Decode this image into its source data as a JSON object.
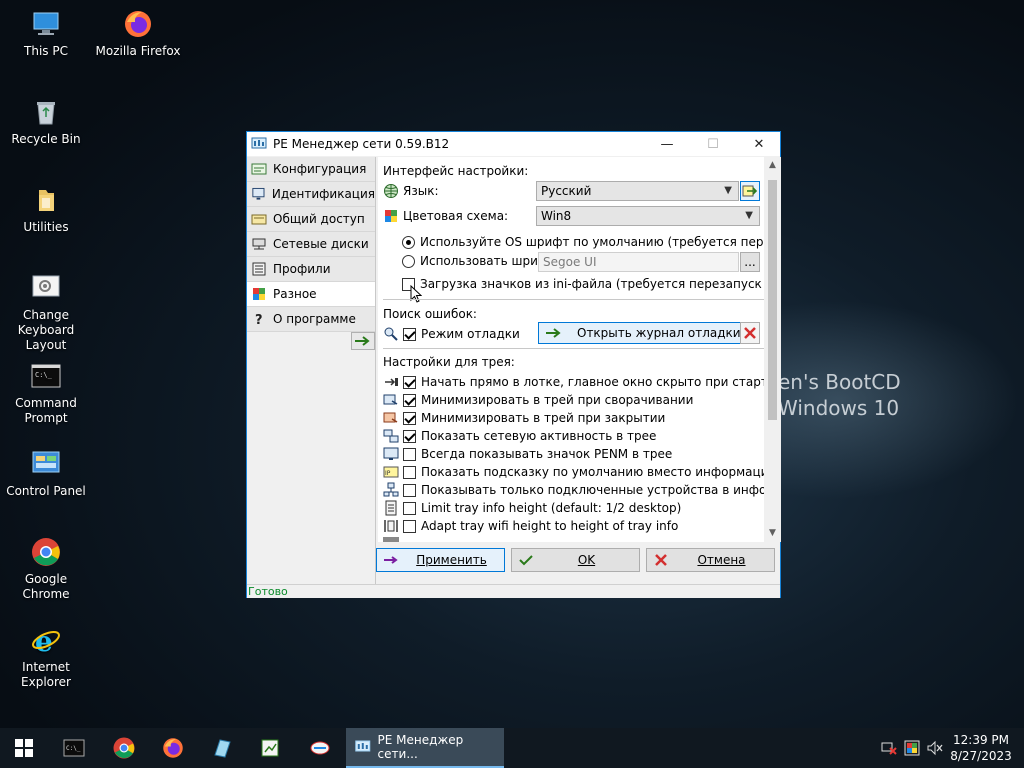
{
  "desktop": {
    "background_text": [
      "en's BootCD",
      "Windows 10"
    ],
    "icons": [
      {
        "label": "This PC",
        "icon": "computer-icon"
      },
      {
        "label": "Mozilla Firefox",
        "icon": "firefox-icon"
      },
      {
        "label": "Recycle Bin",
        "icon": "recycle-bin-icon"
      },
      {
        "label": "Utilities",
        "icon": "folder-icon"
      },
      {
        "label": "Change\nKeyboard Layout",
        "icon": "keyboard-layout-icon"
      },
      {
        "label": "Command\nPrompt",
        "icon": "command-prompt-icon"
      },
      {
        "label": "Control Panel",
        "icon": "control-panel-icon"
      },
      {
        "label": "Google Chrome",
        "icon": "chrome-icon"
      },
      {
        "label": "Internet Explorer",
        "icon": "internet-explorer-icon"
      }
    ]
  },
  "window": {
    "title": "PE Менеджер сети 0.59.B12",
    "controls": {
      "minimize": "—",
      "maximize": "☐",
      "close": "✕"
    },
    "nav": [
      {
        "label": "Конфигурация",
        "icon": "network-config-icon"
      },
      {
        "label": "Идентификация",
        "icon": "monitor-icon"
      },
      {
        "label": "Общий доступ",
        "icon": "share-folder-icon"
      },
      {
        "label": "Сетевые диски",
        "icon": "network-drive-icon"
      },
      {
        "label": "Профили",
        "icon": "profile-icon"
      },
      {
        "label": "Разное",
        "icon": "misc-icon",
        "active": true
      },
      {
        "label": "О программе",
        "icon": "question-icon"
      }
    ],
    "interface": {
      "section_label": "Интерфейс настройки:",
      "language_label": "Язык:",
      "language_value": "Русский",
      "color_scheme_label": "Цветовая схема:",
      "color_scheme_value": "Win8",
      "os_font_label": "Используйте OS шрифт по умолчанию (требуется перезапуск GU",
      "custom_font_label": "Использовать шрифт:",
      "custom_font_value": "Segoe UI",
      "font_browse_label": "...",
      "load_icons_label": "Загрузка значков из ini-файла (требуется перезапуск GUI)"
    },
    "debug": {
      "section_label": "Поиск ошибок:",
      "debug_mode_label": "Режим отладки",
      "open_log_label": "Открыть журнал отладки..."
    },
    "tray": {
      "section_label": "Настройки для трея:",
      "items": [
        {
          "label": "Начать прямо в лотке, главное окно скрыто при старте програм",
          "checked": true
        },
        {
          "label": "Минимизировать в трей при сворачивании",
          "checked": true
        },
        {
          "label": "Минимизировать в трей при закрытии",
          "checked": true
        },
        {
          "label": "Показать сетевую активность в трее",
          "checked": true
        },
        {
          "label": "Всегда показывать значок PENM в трее",
          "checked": false
        },
        {
          "label": "Показать подсказку по умолчанию вместо информационное ок",
          "checked": false
        },
        {
          "label": "Показывать только подключенные устройства в информационн",
          "checked": false
        },
        {
          "label": "Limit tray info height (default: 1/2 desktop)",
          "checked": false
        },
        {
          "label": "Adapt tray wifi height to height of tray info",
          "checked": false
        }
      ]
    },
    "buttons": {
      "apply": "Применить",
      "ok": "OK",
      "cancel": "Отмена"
    },
    "status": "Готово"
  },
  "taskbar": {
    "active_window_label": "PE Менеджер сети...",
    "time": "12:39 PM",
    "date": "8/27/2023",
    "pinned": [
      "start-icon",
      "command-prompt-icon",
      "chrome-icon",
      "firefox-icon",
      "app-icon",
      "registry-icon",
      "network-icon"
    ]
  }
}
